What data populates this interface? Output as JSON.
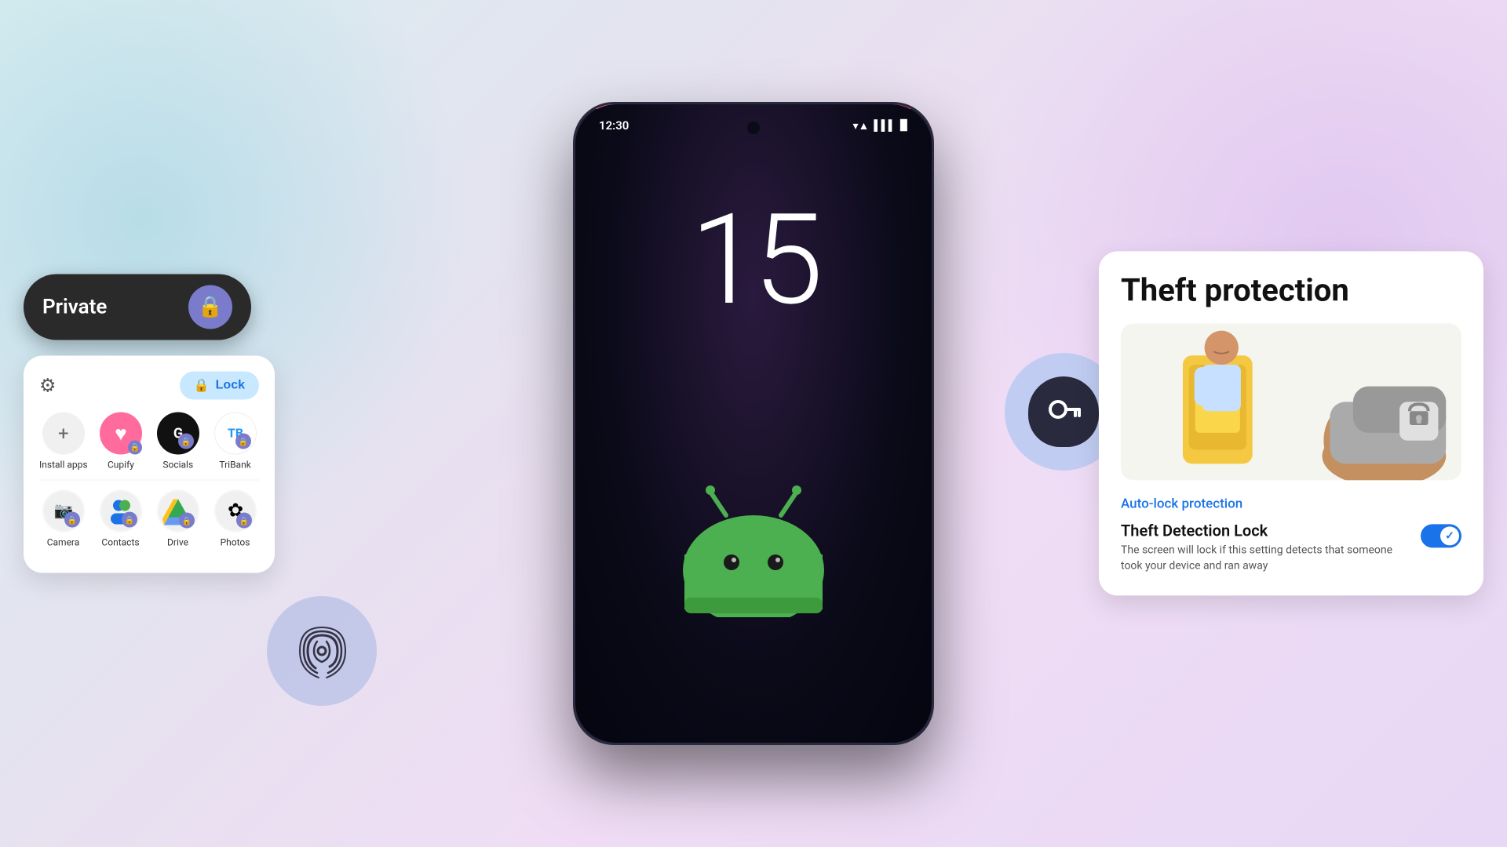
{
  "background": {
    "gradient": "linear-gradient(135deg, #d8eef0 0%, #e8e0f0 40%, #f0ddf5 60%, #e8d8f5 100%)"
  },
  "phone": {
    "status_time": "12:30",
    "clock_number": "15",
    "wifi_icon": "▲",
    "signal_icon": "▌▌",
    "battery_icon": "▉"
  },
  "private_button": {
    "label": "Private",
    "icon": "🔒"
  },
  "app_grid": {
    "lock_button_label": "Lock",
    "apps_row1": [
      {
        "name": "Install apps",
        "icon": "+",
        "type": "install"
      },
      {
        "name": "Cupify",
        "icon": "❤",
        "type": "cupify"
      },
      {
        "name": "Socials",
        "icon": "S",
        "type": "socials"
      },
      {
        "name": "TriBank",
        "icon": "T",
        "type": "tribank"
      }
    ],
    "apps_row2": [
      {
        "name": "Camera",
        "icon": "📷",
        "type": "camera"
      },
      {
        "name": "Contacts",
        "icon": "👤",
        "type": "contacts"
      },
      {
        "name": "Drive",
        "icon": "▲",
        "type": "drive"
      },
      {
        "name": "Photos",
        "icon": "✿",
        "type": "photos"
      }
    ]
  },
  "theft_card": {
    "title": "Theft protection",
    "auto_lock_label": "Auto-lock protection",
    "detection_title": "Theft Detection Lock",
    "detection_desc": "The screen will lock if this setting detects that someone took your device and ran away",
    "toggle_state": "on"
  },
  "fingerprint_bubble": {
    "icon": "⦿"
  },
  "security_bubble": {
    "icon": "🔑"
  }
}
